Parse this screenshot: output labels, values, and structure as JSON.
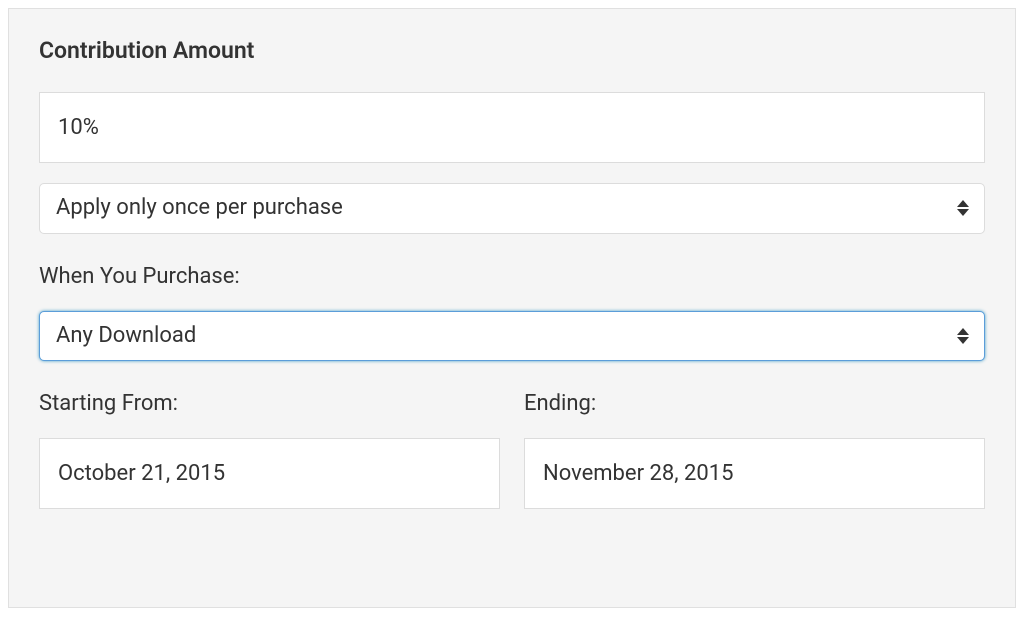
{
  "section": {
    "title": "Contribution Amount"
  },
  "amount": {
    "value": "10%"
  },
  "apply_rule": {
    "selected": "Apply only once per purchase"
  },
  "purchase": {
    "label": "When You Purchase:",
    "selected": "Any Download"
  },
  "dates": {
    "start": {
      "label": "Starting From:",
      "value": "October 21, 2015"
    },
    "end": {
      "label": "Ending:",
      "value": "November 28, 2015"
    }
  }
}
